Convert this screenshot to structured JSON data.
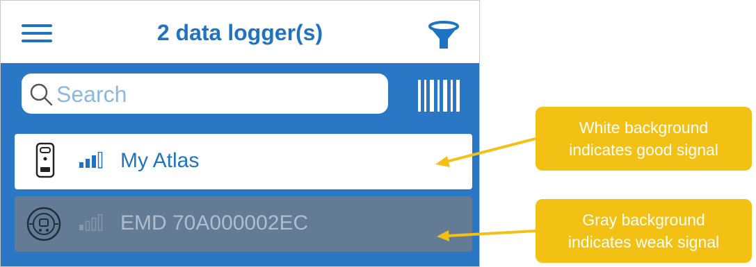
{
  "header": {
    "title": "2 data logger(s)",
    "menu_icon": "hamburger-menu-icon",
    "filter_icon": "filter-funnel-icon"
  },
  "search": {
    "placeholder": "Search",
    "icon": "magnifier-icon",
    "barcode_icon": "barcode-scan-icon"
  },
  "devices": [
    {
      "name": "My Atlas",
      "signal": "good",
      "background": "white",
      "icon": "logger-device-icon",
      "signal_bars": 3
    },
    {
      "name": "EMD 70A000002EC",
      "signal": "weak",
      "background": "gray",
      "icon": "round-logger-icon",
      "signal_bars": 1
    }
  ],
  "annotations": [
    {
      "line1": "White background",
      "line2": "indicates good signal"
    },
    {
      "line1": "Gray background",
      "line2": "indicates weak signal"
    }
  ],
  "colors": {
    "brand_blue": "#2a77c6",
    "title_blue": "#1f74c2",
    "weak_row_gray": "#647b95",
    "callout_yellow": "#f2c114"
  }
}
